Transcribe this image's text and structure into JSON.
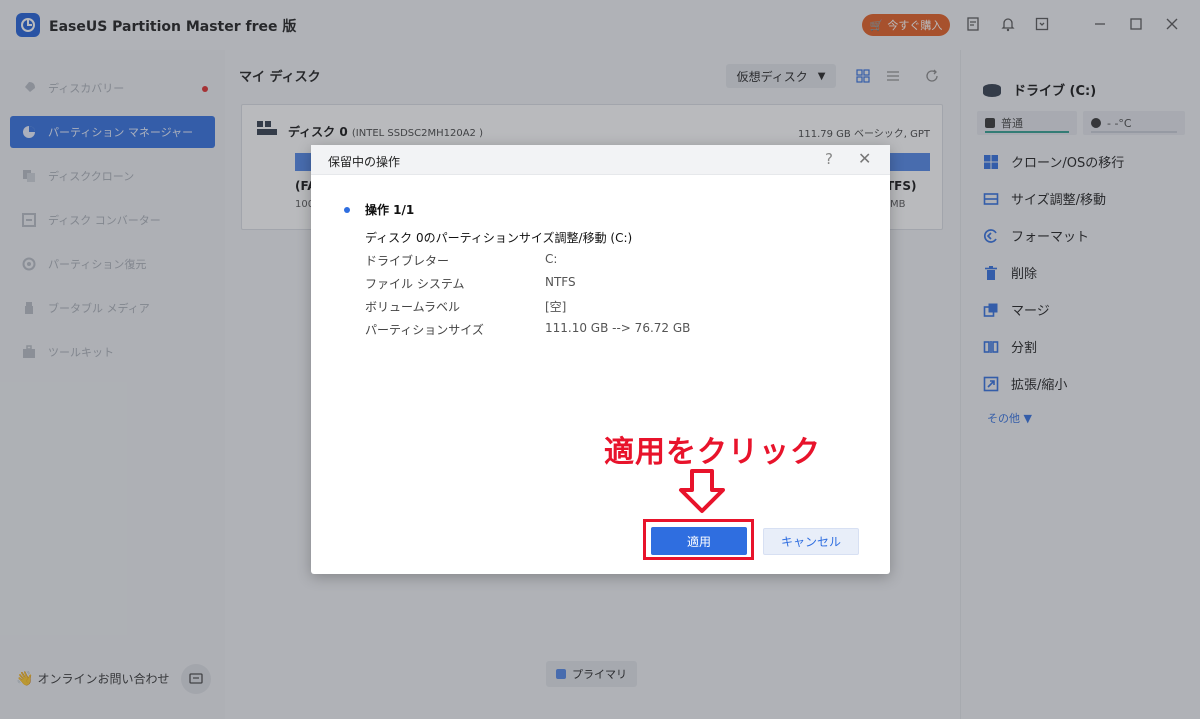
{
  "app": {
    "title": "EaseUS Partition Master free 版",
    "buy_label": "今すぐ購入"
  },
  "sidebar": {
    "items": [
      {
        "label": "ディスカバリー",
        "icon": "rocket-icon"
      },
      {
        "label": "パーティション マネージャー",
        "icon": "pie-chart-icon"
      },
      {
        "label": "ディスククローン",
        "icon": "clone-icon"
      },
      {
        "label": "ディスク コンバーター",
        "icon": "convert-icon"
      },
      {
        "label": "パーティション復元",
        "icon": "recover-icon"
      },
      {
        "label": "ブータブル メディア",
        "icon": "usb-icon"
      },
      {
        "label": "ツールキット",
        "icon": "toolkit-icon"
      }
    ],
    "contact_label": "オンラインお問い合わせ"
  },
  "main": {
    "title": "マイ ディスク",
    "virtual_disk_label": "仮想ディスク",
    "disk": {
      "name": "ディスク 0",
      "model": "(INTEL SSDSC2MH120A2 )",
      "info": "111.79 GB ベーシック, GPT",
      "left_part_label": "(FA",
      "left_part_size": "100",
      "right_part_label": "TFS)",
      "right_part_size": "MB"
    },
    "legend_label": "プライマリ"
  },
  "right_panel": {
    "drive_title": "ドライブ (C:)",
    "health_label": "普通",
    "temp_label": "- -°C",
    "actions": [
      {
        "label": "クローン/OSの移行",
        "icon": "windows-icon"
      },
      {
        "label": "サイズ調整/移動",
        "icon": "resize-icon"
      },
      {
        "label": "フォーマット",
        "icon": "format-icon"
      },
      {
        "label": "削除",
        "icon": "trash-icon"
      },
      {
        "label": "マージ",
        "icon": "merge-icon"
      },
      {
        "label": "分割",
        "icon": "split-icon"
      },
      {
        "label": "拡張/縮小",
        "icon": "expand-icon"
      }
    ],
    "more_label": "その他 ▼"
  },
  "dialog": {
    "title": "保留中の操作",
    "op_title": "操作 1/1",
    "op_desc": "ディスク 0のパーティションサイズ調整/移動 (C:)",
    "rows": [
      {
        "key": "ドライブレター",
        "value": "C:"
      },
      {
        "key": "ファイル システム",
        "value": "NTFS"
      },
      {
        "key": "ボリュームラベル",
        "value": "[空]"
      },
      {
        "key": "パーティションサイズ",
        "value": "111.10 GB --> 76.72 GB"
      }
    ],
    "apply_label": "適用",
    "cancel_label": "キャンセル"
  },
  "annotation": {
    "text": "適用をクリック",
    "color": "#e8132b"
  },
  "colors": {
    "accent": "#2f6ee0",
    "buy": "#e35c1e",
    "health": "#2e9e8f"
  }
}
